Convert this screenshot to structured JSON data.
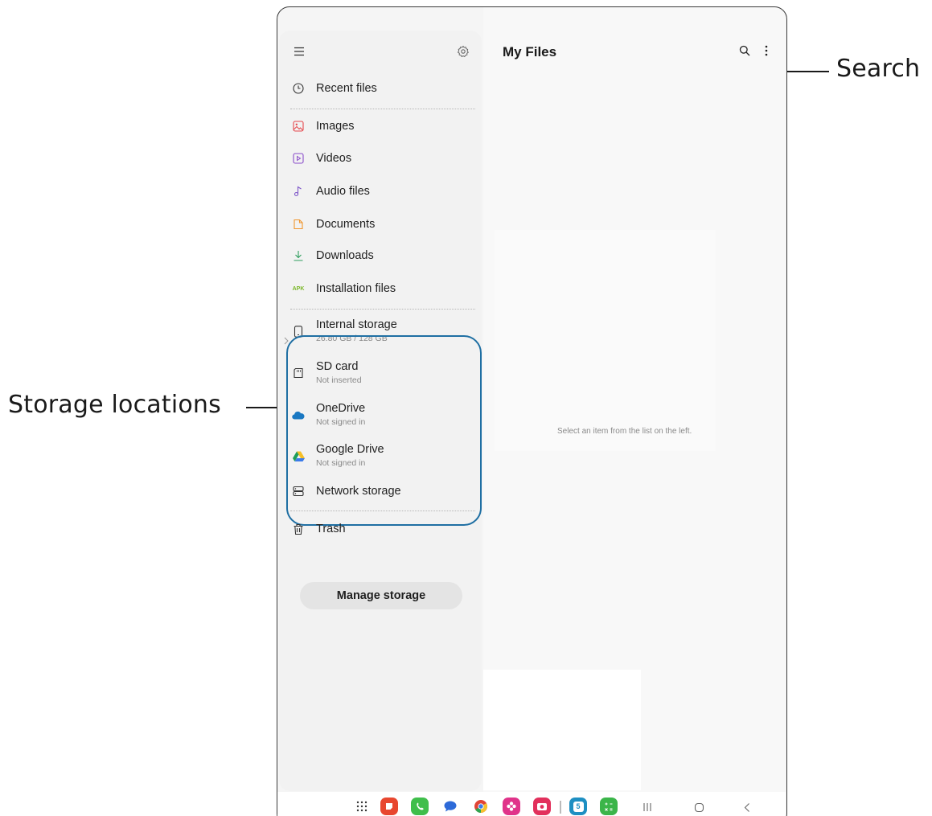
{
  "callouts": {
    "search": "Search",
    "storage": "Storage locations"
  },
  "sidebar": {
    "menu_icon": "hamburger-menu-icon",
    "settings_icon": "gear-icon",
    "recent": {
      "label": "Recent files",
      "icon": "clock-icon"
    },
    "categories": [
      {
        "label": "Images",
        "icon": "image-icon",
        "color": "#e5474c"
      },
      {
        "label": "Videos",
        "icon": "video-icon",
        "color": "#8a4cc9"
      },
      {
        "label": "Audio files",
        "icon": "music-note-icon",
        "color": "#7c54c8"
      },
      {
        "label": "Documents",
        "icon": "document-icon",
        "color": "#f0962e"
      },
      {
        "label": "Downloads",
        "icon": "download-icon",
        "color": "#2f9e5e"
      },
      {
        "label": "Installation files",
        "icon": "apk-icon",
        "badge": "APK",
        "color": "#7bb728"
      }
    ],
    "storage": [
      {
        "label": "Internal storage",
        "sub": "26.80 GB / 128 GB",
        "icon": "phone-icon"
      },
      {
        "label": "SD card",
        "sub": "Not inserted",
        "icon": "sd-card-icon"
      },
      {
        "label": "OneDrive",
        "sub": "Not signed in",
        "icon": "onedrive-cloud-icon",
        "color": "#1a78c2"
      },
      {
        "label": "Google Drive",
        "sub": "Not signed in",
        "icon": "google-drive-icon"
      },
      {
        "label": "Network storage",
        "icon": "server-icon"
      }
    ],
    "trash": {
      "label": "Trash",
      "icon": "trash-icon"
    },
    "manage_button": "Manage storage"
  },
  "main": {
    "title": "My Files",
    "search_icon": "search-icon",
    "more_icon": "more-vertical-icon",
    "empty_message": "Select an item from the list on the left."
  },
  "taskbar": {
    "apps": [
      {
        "icon": "app-drawer-icon"
      },
      {
        "icon": "notes-app-icon",
        "color": "#e8472f"
      },
      {
        "icon": "phone-app-icon",
        "color": "#3fbe4b"
      },
      {
        "icon": "messages-app-icon",
        "color": "#2d6ad8"
      },
      {
        "icon": "chrome-app-icon"
      },
      {
        "icon": "galaxy-store-app-icon",
        "color": "#e0338a"
      },
      {
        "icon": "camera-app-icon",
        "color": "#e2305c"
      },
      {
        "icon": "calendar-app-icon",
        "color": "#1e8fc2",
        "text": "5"
      },
      {
        "icon": "calculator-app-icon",
        "color": "#3bb54a"
      }
    ],
    "nav": [
      "recents-button-icon",
      "home-button-icon",
      "back-button-icon"
    ]
  }
}
